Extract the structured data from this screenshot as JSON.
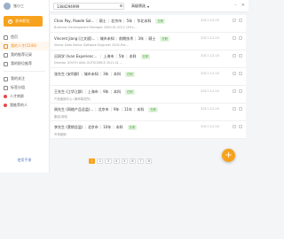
{
  "user": {
    "name": "张小三"
  },
  "sidebar": {
    "publish_label": "发布职位",
    "items": [
      {
        "label": "首页",
        "active": false
      },
      {
        "label": "我的人才(5246)",
        "active": true
      },
      {
        "label": "我的推荐记录",
        "active": false
      },
      {
        "label": "我的职位推荐",
        "active": false
      }
    ],
    "items2": [
      {
        "label": "我的关注"
      },
      {
        "label": "标签分组"
      }
    ],
    "groups": [
      {
        "label": "人才库群",
        "color": "#e94747"
      },
      {
        "label": "我推荐的人",
        "color": "#e94747"
      }
    ],
    "footer": "使用手册"
  },
  "search": {
    "value": "1384294999",
    "filter_label": "高级筛选"
  },
  "rows": [
    {
      "name": "Chan Pay, Powde Sal...",
      "meta": [
        "硕士",
        "北京市",
        "5年",
        "华北本科"
      ],
      "tag": "在职",
      "sub": "Business Development Manager 2009.01-2012 (3Yrs...",
      "date": "2017-12-15"
    },
    {
      "name": "Vincent Jiang (江文斌)...",
      "meta": [
        "城市未知",
        "前期技术",
        "3年",
        "硕士"
      ],
      "tag": "在职",
      "sub": "Senior Data Senior Software Engineer 2002-Pre...",
      "date": "2017-12-15"
    },
    {
      "name": "吕同学 (Ivan Experience ...)",
      "meta": [
        "上海市",
        "5年",
        "本科"
      ],
      "tag": "在职",
      "sub": "Director SOUTH ASIA OUTSOURCE 2011.01 ...",
      "date": "2017-12-15"
    },
    {
      "name": "张先生 (安利群)",
      "meta": [
        "城市未知",
        "3年",
        "本科"
      ],
      "tag": "在职",
      "sub": "",
      "date": "2017-12-15"
    },
    {
      "name": "王先生 (江华江群)",
      "meta": [
        "上海市",
        "9年",
        "本科"
      ],
      "tag": "在职",
      "sub": "产品营销中心 (律师事务所)",
      "date": "2017-12-15"
    },
    {
      "name": "周先生 (网络产品总监)...",
      "meta": [
        "北京市",
        "9年",
        "11年",
        "本科"
      ],
      "tag": "在职",
      "sub": "集团-网络",
      "date": "2017-12-15"
    },
    {
      "name": "李先生 (营销总监)",
      "meta": [
        "北京市",
        "10年",
        "本科"
      ],
      "tag": "在职",
      "sub": "市场营销",
      "date": "2017-12-15"
    }
  ],
  "pager": {
    "prev": "上一页",
    "pages": [
      "1",
      "2",
      "3",
      "4",
      "5",
      "6",
      "7",
      "8"
    ],
    "active": "1",
    "next": "下一页"
  },
  "fab_label": "+"
}
